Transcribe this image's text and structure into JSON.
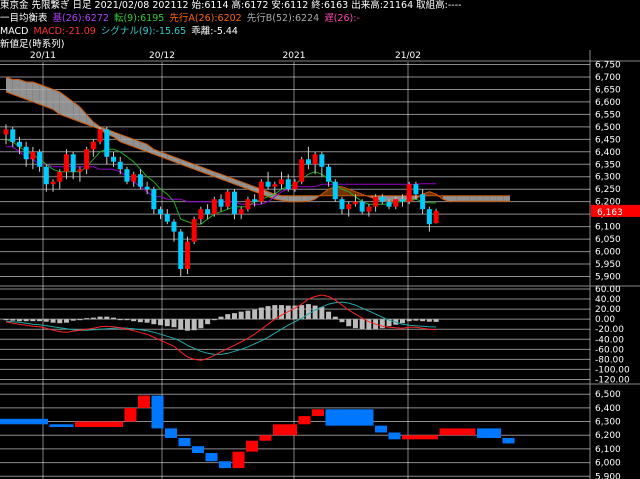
{
  "header": {
    "line1": "東京金 先限繋ぎ 日足 2021/02/08 202112 始:6114 高:6172 安:6112 終:6163 出来高:21164 取組高:----",
    "line2": {
      "label": "一目均衡表",
      "base": "基(26):6272",
      "conv": "転(9):6195",
      "spanA": "先行A(26):6202",
      "spanB": "先行B(52):6224",
      "lag": "遅(26):-"
    },
    "line3": {
      "label": "MACD",
      "macd": "MACD:-21.09",
      "signal": "シグナル(9):-15.65",
      "diff": "乖離:-5.44"
    },
    "line4": "新値足(時系列)"
  },
  "colors": {
    "up": "#ff0000",
    "down": "#00ccff",
    "base": "#9900cc",
    "conv": "#22aa22",
    "cloud_edge": "#cc5500",
    "cloud_bull": "#aaaaaa",
    "cloud_bear": "#8b3a00",
    "macd": "#ff2222",
    "signal": "#22aaaa",
    "hist": "#bbbbbb",
    "grid": "#ffffff",
    "price_tag": "#ff0000",
    "newprice_up": "#ff0000",
    "newprice_down": "#0077ff"
  },
  "date_labels": [
    "20/11",
    "20/12",
    "2021",
    "21/02"
  ],
  "price_axis": [
    "6,750",
    "6,700",
    "6,650",
    "6,600",
    "6,550",
    "6,500",
    "6,450",
    "6,400",
    "6,350",
    "6,300",
    "6,250",
    "6,200",
    "6,150",
    "6,100",
    "6,050",
    "6,000",
    "5,950",
    "5,900"
  ],
  "last_price": "6,163",
  "macd_axis": [
    "60.00",
    "40.00",
    "20.00",
    "0.00",
    "-20.00",
    "-40.00",
    "-60.00",
    "-80.00",
    "-100.00",
    "-120.00"
  ],
  "newprice_axis": [
    "6,500",
    "6,400",
    "6,300",
    "6,200",
    "6,100",
    "6,000",
    "5,900"
  ],
  "chart_data": [
    {
      "type": "candlestick",
      "title": "東京金 先限繋ぎ 日足",
      "x_range": [
        "2020-10-29",
        "2021-02-08"
      ],
      "y_range": [
        5870,
        6760
      ],
      "candles": [
        [
          6470,
          6510,
          6430,
          6490
        ],
        [
          6490,
          6500,
          6420,
          6440
        ],
        [
          6440,
          6460,
          6390,
          6420
        ],
        [
          6420,
          6440,
          6340,
          6370
        ],
        [
          6370,
          6420,
          6330,
          6400
        ],
        [
          6400,
          6410,
          6320,
          6340
        ],
        [
          6340,
          6350,
          6240,
          6270
        ],
        [
          6270,
          6290,
          6240,
          6280
        ],
        [
          6280,
          6330,
          6250,
          6320
        ],
        [
          6320,
          6410,
          6290,
          6390
        ],
        [
          6390,
          6400,
          6290,
          6320
        ],
        [
          6320,
          6340,
          6280,
          6330
        ],
        [
          6330,
          6420,
          6310,
          6410
        ],
        [
          6410,
          6450,
          6380,
          6440
        ],
        [
          6440,
          6500,
          6430,
          6490
        ],
        [
          6490,
          6500,
          6350,
          6380
        ],
        [
          6380,
          6400,
          6340,
          6360
        ],
        [
          6360,
          6380,
          6310,
          6330
        ],
        [
          6330,
          6340,
          6270,
          6280
        ],
        [
          6280,
          6320,
          6260,
          6310
        ],
        [
          6310,
          6330,
          6250,
          6260
        ],
        [
          6260,
          6280,
          6230,
          6250
        ],
        [
          6250,
          6260,
          6150,
          6170
        ],
        [
          6170,
          6180,
          6130,
          6150
        ],
        [
          6150,
          6170,
          6110,
          6120
        ],
        [
          6120,
          6130,
          6040,
          6080
        ],
        [
          6080,
          6090,
          5900,
          5930
        ],
        [
          5930,
          6060,
          5910,
          6040
        ],
        [
          6040,
          6140,
          6030,
          6130
        ],
        [
          6130,
          6180,
          6110,
          6170
        ],
        [
          6170,
          6190,
          6130,
          6150
        ],
        [
          6150,
          6220,
          6140,
          6210
        ],
        [
          6210,
          6230,
          6160,
          6180
        ],
        [
          6180,
          6250,
          6170,
          6240
        ],
        [
          6240,
          6250,
          6130,
          6150
        ],
        [
          6150,
          6180,
          6130,
          6170
        ],
        [
          6170,
          6220,
          6160,
          6210
        ],
        [
          6210,
          6230,
          6180,
          6200
        ],
        [
          6200,
          6290,
          6190,
          6280
        ],
        [
          6280,
          6320,
          6250,
          6260
        ],
        [
          6260,
          6280,
          6230,
          6270
        ],
        [
          6270,
          6320,
          6250,
          6290
        ],
        [
          6290,
          6310,
          6240,
          6250
        ],
        [
          6250,
          6290,
          6240,
          6280
        ],
        [
          6280,
          6380,
          6270,
          6370
        ],
        [
          6370,
          6420,
          6330,
          6350
        ],
        [
          6350,
          6400,
          6310,
          6390
        ],
        [
          6390,
          6400,
          6300,
          6340
        ],
        [
          6340,
          6350,
          6260,
          6280
        ],
        [
          6280,
          6290,
          6200,
          6210
        ],
        [
          6210,
          6220,
          6150,
          6170
        ],
        [
          6170,
          6200,
          6140,
          6190
        ],
        [
          6190,
          6230,
          6180,
          6200
        ],
        [
          6200,
          6210,
          6150,
          6160
        ],
        [
          6160,
          6190,
          6140,
          6180
        ],
        [
          6180,
          6230,
          6160,
          6220
        ],
        [
          6220,
          6230,
          6190,
          6200
        ],
        [
          6200,
          6210,
          6170,
          6180
        ],
        [
          6180,
          6220,
          6170,
          6210
        ],
        [
          6210,
          6230,
          6180,
          6200
        ],
        [
          6200,
          6280,
          6190,
          6270
        ],
        [
          6270,
          6280,
          6210,
          6230
        ],
        [
          6230,
          6250,
          6150,
          6170
        ],
        [
          6170,
          6180,
          6080,
          6110
        ],
        [
          6114,
          6172,
          6112,
          6163
        ]
      ],
      "kijun": [
        6420,
        6420,
        6400,
        6380,
        6370,
        6350,
        6350,
        6340,
        6340,
        6340,
        6340,
        6340,
        6340,
        6340,
        6330,
        6330,
        6330,
        6320,
        6300,
        6280,
        6260,
        6240,
        6220,
        6220,
        6210,
        6210,
        6210,
        6200,
        6200,
        6200,
        6200,
        6200,
        6200,
        6200,
        6200,
        6190,
        6190,
        6190,
        6190,
        6200,
        6220,
        6240,
        6250,
        6260,
        6260,
        6260,
        6260,
        6270,
        6270,
        6270,
        6270,
        6270,
        6270,
        6270,
        6270,
        6270,
        6270,
        6270,
        6270,
        6270,
        6270,
        6270,
        6272,
        6272,
        6272
      ],
      "tenkan": [
        6450,
        6440,
        6420,
        6400,
        6390,
        6370,
        6350,
        6330,
        6320,
        6320,
        6320,
        6320,
        6340,
        6370,
        6400,
        6410,
        6410,
        6400,
        6380,
        6360,
        6330,
        6300,
        6280,
        6250,
        6230,
        6200,
        6130,
        6120,
        6110,
        6110,
        6130,
        6150,
        6160,
        6170,
        6180,
        6180,
        6180,
        6200,
        6210,
        6220,
        6230,
        6250,
        6260,
        6270,
        6290,
        6310,
        6320,
        6310,
        6290,
        6270,
        6250,
        6240,
        6220,
        6200,
        6190,
        6190,
        6190,
        6190,
        6200,
        6200,
        6210,
        6210,
        6200,
        6195,
        6195
      ],
      "cloud": {
        "spanA": [
          6640,
          6630,
          6620,
          6610,
          6600,
          6590,
          6580,
          6570,
          6550,
          6540,
          6530,
          6520,
          6510,
          6500,
          6490,
          6470,
          6460,
          6440,
          6430,
          6420,
          6410,
          6400,
          6390,
          6380,
          6370,
          6360,
          6350,
          6340,
          6330,
          6320,
          6310,
          6300,
          6290,
          6280,
          6270,
          6260,
          6250,
          6240,
          6230,
          6220,
          6210,
          6205,
          6200,
          6200,
          6200,
          6202,
          6210,
          6230,
          6250,
          6260,
          6260,
          6250,
          6240,
          6230,
          6220,
          6210,
          6202,
          6202,
          6202,
          6202,
          6202,
          6210,
          6230,
          6240,
          6230,
          6210,
          6200,
          6202,
          6202,
          6202,
          6202,
          6202,
          6202,
          6202,
          6202,
          6202
        ],
        "spanB": [
          6700,
          6690,
          6690,
          6680,
          6680,
          6670,
          6660,
          6650,
          6640,
          6620,
          6600,
          6580,
          6550,
          6520,
          6500,
          6490,
          6480,
          6470,
          6460,
          6450,
          6440,
          6430,
          6410,
          6400,
          6390,
          6380,
          6370,
          6360,
          6350,
          6340,
          6330,
          6320,
          6310,
          6300,
          6290,
          6280,
          6270,
          6260,
          6250,
          6240,
          6230,
          6224,
          6224,
          6224,
          6224,
          6224,
          6224,
          6224,
          6224,
          6224,
          6224,
          6224,
          6224,
          6224,
          6224,
          6224,
          6224,
          6224,
          6224,
          6224,
          6224,
          6224,
          6224,
          6224,
          6224,
          6224,
          6224,
          6224,
          6224,
          6224,
          6224,
          6224,
          6224,
          6224,
          6224,
          6224
        ]
      }
    },
    {
      "type": "line",
      "title": "MACD",
      "y_range": [
        -125,
        62
      ],
      "series": [
        {
          "name": "MACD",
          "values": [
            -5,
            -8,
            -10,
            -12,
            -14,
            -15,
            -18,
            -22,
            -25,
            -26,
            -24,
            -22,
            -20,
            -18,
            -15,
            -14,
            -15,
            -17,
            -20,
            -23,
            -27,
            -30,
            -36,
            -42,
            -48,
            -54,
            -65,
            -75,
            -80,
            -82,
            -78,
            -72,
            -65,
            -58,
            -52,
            -45,
            -38,
            -30,
            -20,
            -10,
            0,
            8,
            15,
            22,
            30,
            40,
            45,
            48,
            45,
            38,
            28,
            18,
            10,
            2,
            -5,
            -10,
            -14,
            -16,
            -17,
            -18,
            -16,
            -16,
            -18,
            -20,
            -21.09
          ]
        },
        {
          "name": "シグナル(9)",
          "values": [
            -4,
            -5,
            -6,
            -8,
            -10,
            -11,
            -13,
            -15,
            -17,
            -19,
            -21,
            -22,
            -22,
            -21,
            -20,
            -19,
            -18,
            -17,
            -18,
            -19,
            -21,
            -23,
            -26,
            -30,
            -34,
            -38,
            -44,
            -52,
            -58,
            -64,
            -68,
            -70,
            -70,
            -68,
            -64,
            -60,
            -55,
            -49,
            -43,
            -36,
            -28,
            -20,
            -12,
            -5,
            2,
            10,
            18,
            24,
            30,
            33,
            34,
            32,
            28,
            22,
            16,
            10,
            4,
            -2,
            -6,
            -10,
            -12,
            -13,
            -14,
            -15,
            -15.65
          ]
        },
        {
          "name": "乖離",
          "values": [
            -1,
            -3,
            -4,
            -4,
            -4,
            -4,
            -5,
            -7,
            -8,
            -7,
            -3,
            0,
            2,
            3,
            5,
            5,
            3,
            0,
            -2,
            -4,
            -6,
            -7,
            -10,
            -12,
            -14,
            -16,
            -21,
            -23,
            -22,
            -18,
            -10,
            -2,
            5,
            10,
            12,
            15,
            17,
            19,
            23,
            26,
            28,
            28,
            27,
            27,
            28,
            30,
            27,
            24,
            15,
            5,
            -6,
            -14,
            -18,
            -20,
            -21,
            -20,
            -18,
            -14,
            -11,
            -8,
            -4,
            -3,
            -4,
            -5,
            -5.44
          ]
        }
      ]
    },
    {
      "type": "bar",
      "title": "新値足(時系列)",
      "y_range": [
        5880,
        6560
      ],
      "blocks": [
        {
          "dir": "down",
          "values": [
            6280
          ]
        },
        {
          "dir": "down",
          "values": [
            6260
          ]
        },
        {
          "dir": "up",
          "values": [
            6300,
            6400,
            6490
          ]
        },
        {
          "dir": "down",
          "values": [
            6250,
            6180,
            6120,
            6070,
            6010,
            5960
          ]
        },
        {
          "dir": "up",
          "values": [
            6080,
            6160,
            6200
          ]
        },
        {
          "dir": "up",
          "values": [
            6280,
            6340,
            6390
          ]
        },
        {
          "dir": "down",
          "values": [
            6270,
            6220,
            6170
          ]
        },
        {
          "dir": "up",
          "values": [
            6200
          ]
        },
        {
          "dir": "up",
          "values": [
            6250
          ]
        },
        {
          "dir": "down",
          "values": [
            6180,
            6140
          ]
        }
      ]
    }
  ]
}
